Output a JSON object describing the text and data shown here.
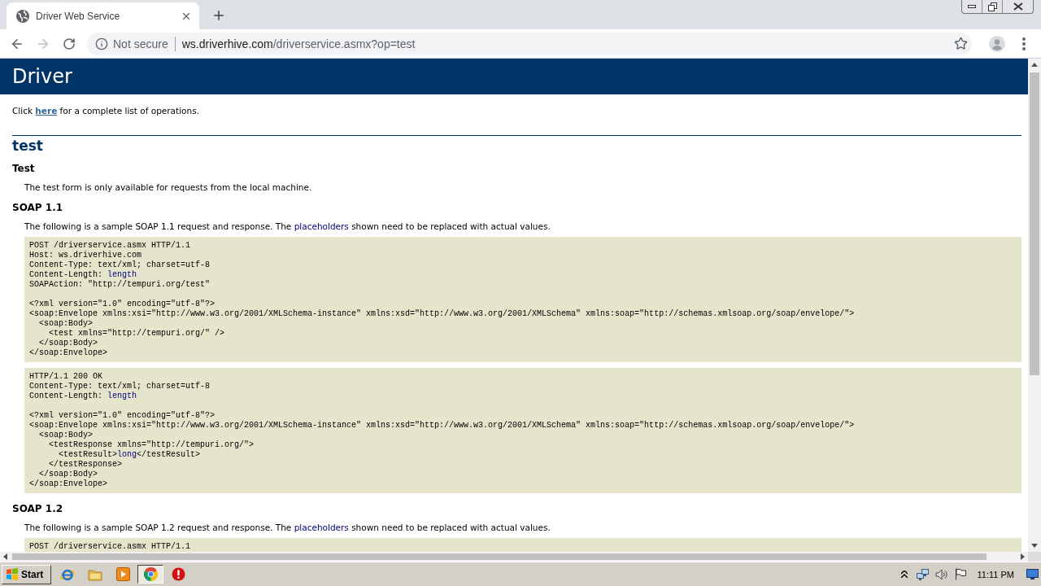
{
  "browser": {
    "tabs": [
      {
        "title": "Driver Web Service",
        "selected": true
      }
    ],
    "address_bar": {
      "security": "Not secure",
      "host": "ws.driverhive.com",
      "path": "/driverservice.asmx?op=test"
    }
  },
  "page": {
    "title": "Driver",
    "intro": [
      {
        "kind": "plain",
        "text": "Click "
      },
      {
        "kind": "link",
        "text": "here"
      },
      {
        "kind": "plain",
        "text": " for a complete list of operations."
      }
    ],
    "operation": "test",
    "sections": [
      {
        "heading": "Test",
        "text": [
          {
            "kind": "plain",
            "text": "The test form is only available for requests from the local machine."
          }
        ]
      },
      {
        "heading": "SOAP 1.1",
        "text": [
          {
            "kind": "plain",
            "text": "The following is a sample SOAP 1.1 request and response. The "
          },
          {
            "kind": "placeholder",
            "text": "placeholders"
          },
          {
            "kind": "plain",
            "text": " shown need to be replaced with actual values."
          }
        ],
        "code_blocks": [
          {
            "headers": [
              [
                {
                  "kind": "plain",
                  "text": "POST /driverservice.asmx HTTP/1.1"
                }
              ],
              [
                {
                  "kind": "plain",
                  "text": "Host: ws.driverhive.com"
                }
              ],
              [
                {
                  "kind": "plain",
                  "text": "Content-Type: text/xml; charset=utf-8"
                }
              ],
              [
                {
                  "kind": "plain",
                  "text": "Content-Length: "
                },
                {
                  "kind": "placeholder",
                  "text": "length"
                }
              ],
              [
                {
                  "kind": "plain",
                  "text": "SOAPAction: \"http://tempuri.org/test\""
                }
              ]
            ],
            "body": [
              [
                {
                  "kind": "plain",
                  "text": "<?xml version=\"1.0\" encoding=\"utf-8\"?>"
                }
              ],
              [
                {
                  "kind": "plain",
                  "text": "<soap:Envelope xmlns:xsi=\"http://www.w3.org/2001/XMLSchema-instance\" xmlns:xsd=\"http://www.w3.org/2001/XMLSchema\" xmlns:soap=\"http://schemas.xmlsoap.org/soap/envelope/\">"
                }
              ],
              [
                {
                  "kind": "plain",
                  "text": "  <soap:Body>"
                }
              ],
              [
                {
                  "kind": "plain",
                  "text": "    <test xmlns=\"http://tempuri.org/\" />"
                }
              ],
              [
                {
                  "kind": "plain",
                  "text": "  </soap:Body>"
                }
              ],
              [
                {
                  "kind": "plain",
                  "text": "</soap:Envelope>"
                }
              ]
            ]
          },
          {
            "headers": [
              [
                {
                  "kind": "plain",
                  "text": "HTTP/1.1 200 OK"
                }
              ],
              [
                {
                  "kind": "plain",
                  "text": "Content-Type: text/xml; charset=utf-8"
                }
              ],
              [
                {
                  "kind": "plain",
                  "text": "Content-Length: "
                },
                {
                  "kind": "placeholder",
                  "text": "length"
                }
              ]
            ],
            "body": [
              [
                {
                  "kind": "plain",
                  "text": "<?xml version=\"1.0\" encoding=\"utf-8\"?>"
                }
              ],
              [
                {
                  "kind": "plain",
                  "text": "<soap:Envelope xmlns:xsi=\"http://www.w3.org/2001/XMLSchema-instance\" xmlns:xsd=\"http://www.w3.org/2001/XMLSchema\" xmlns:soap=\"http://schemas.xmlsoap.org/soap/envelope/\">"
                }
              ],
              [
                {
                  "kind": "plain",
                  "text": "  <soap:Body>"
                }
              ],
              [
                {
                  "kind": "plain",
                  "text": "    <testResponse xmlns=\"http://tempuri.org/\">"
                }
              ],
              [
                {
                  "kind": "plain",
                  "text": "      <testResult>"
                },
                {
                  "kind": "placeholder",
                  "text": "long"
                },
                {
                  "kind": "plain",
                  "text": "</testResult>"
                }
              ],
              [
                {
                  "kind": "plain",
                  "text": "    </testResponse>"
                }
              ],
              [
                {
                  "kind": "plain",
                  "text": "  </soap:Body>"
                }
              ],
              [
                {
                  "kind": "plain",
                  "text": "</soap:Envelope>"
                }
              ]
            ]
          }
        ]
      },
      {
        "heading": "SOAP 1.2",
        "text": [
          {
            "kind": "plain",
            "text": "The following is a sample SOAP 1.2 request and response. The "
          },
          {
            "kind": "placeholder",
            "text": "placeholders"
          },
          {
            "kind": "plain",
            "text": " shown need to be replaced with actual values."
          }
        ],
        "code_blocks": [
          {
            "headers": [
              [
                {
                  "kind": "plain",
                  "text": "POST /driverservice.asmx HTTP/1.1"
                }
              ]
            ]
          }
        ]
      }
    ]
  },
  "taskbar": {
    "start": "Start",
    "apps": [
      {
        "kind": "ie",
        "selected": false
      },
      {
        "kind": "folder",
        "selected": false
      },
      {
        "kind": "media",
        "selected": false
      },
      {
        "kind": "chrome",
        "selected": true
      },
      {
        "kind": "stop",
        "selected": false
      }
    ],
    "clock": "11:11 PM"
  }
}
